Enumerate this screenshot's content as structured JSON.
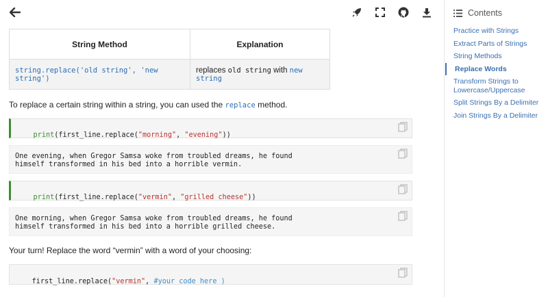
{
  "topbar": {
    "back_icon": "arrow-left-icon",
    "icons": [
      "rocket-icon",
      "fullscreen-icon",
      "github-icon",
      "download-icon"
    ]
  },
  "table": {
    "headers": [
      "String Method",
      "Explanation"
    ],
    "row": {
      "method": "string.replace('old string', 'new string')",
      "explanation_prefix": "replaces",
      "old": "old string",
      "with_word": "with",
      "new": "new string"
    }
  },
  "intro": {
    "before": "To replace a certain string within a string, you can used the",
    "code": "replace",
    "after": "method."
  },
  "cells": {
    "input1": {
      "fn": "print",
      "a": "(first_line.replace(",
      "s1": "\"morning\"",
      "sep": ", ",
      "s2": "\"evening\"",
      "end": "))"
    },
    "output1": [
      "One evening, when Gregor Samsa woke from troubled dreams, he found",
      "himself transformed in his bed into a horrible vermin."
    ],
    "input2": {
      "fn": "print",
      "a": "(first_line.replace(",
      "s1": "\"vermin\"",
      "sep": ", ",
      "s2": "\"grilled cheese\"",
      "end": "))"
    },
    "output2": [
      "One morning, when Gregor Samsa woke from troubled dreams, he found",
      "himself transformed in his bed into a horrible grilled cheese."
    ],
    "input3": {
      "a": "first_line.replace(",
      "s1": "\"vermin\"",
      "sep": ", ",
      "comment": "#your code here )"
    }
  },
  "turn_text": "Your turn! Replace the word “vermin” with a word of your choosing:",
  "toc": {
    "title": "Contents",
    "items": [
      "Practice with Strings",
      "Extract Parts of Strings",
      "String Methods",
      "Replace Words",
      "Transform Strings to Lowercase/Uppercase",
      "Split Strings By a Delimiter",
      "Join Strings By a Delimiter"
    ],
    "active_index": 3
  },
  "colors": {
    "accent": "#3a6fb0",
    "input_border": "#3c8d2f",
    "string": "#b9342f"
  }
}
